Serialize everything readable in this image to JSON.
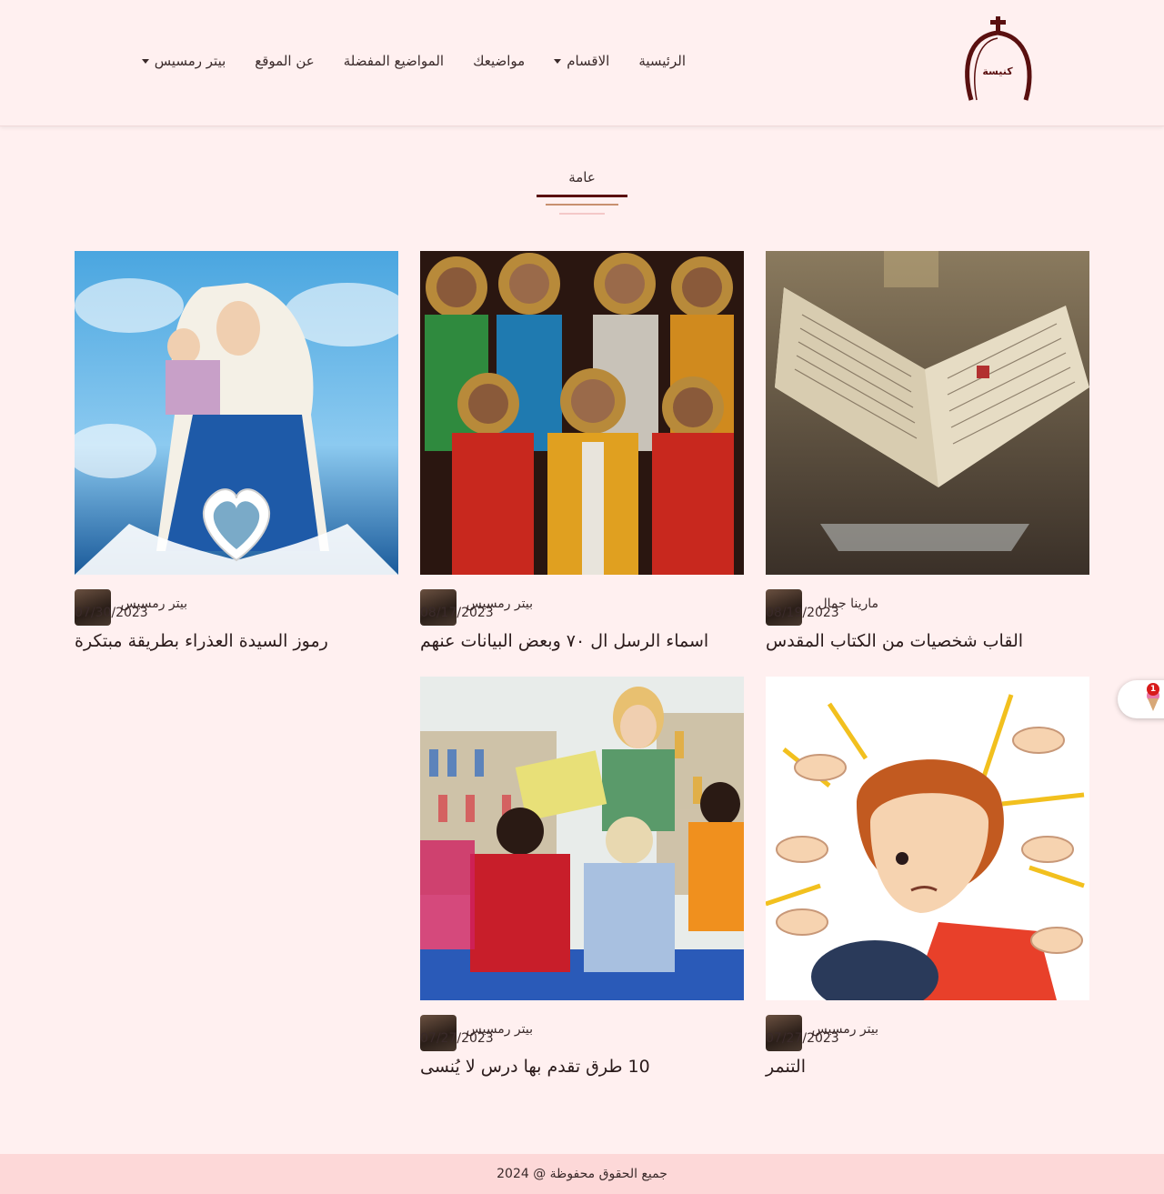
{
  "nav": {
    "items": [
      {
        "label": "الرئيسية",
        "has_dropdown": false
      },
      {
        "label": "الاقسام",
        "has_dropdown": true
      },
      {
        "label": "مواضيعك",
        "has_dropdown": false
      },
      {
        "label": "المواضيع المفضلة",
        "has_dropdown": false
      },
      {
        "label": "عن الموقع",
        "has_dropdown": false
      },
      {
        "label": "بيتر رمسيس",
        "has_dropdown": true
      }
    ]
  },
  "logo": {
    "text": "كنيسة"
  },
  "section": {
    "title": "عامة"
  },
  "posts": [
    {
      "title": "القاب شخصيات من الكتاب المقدس",
      "author": "مارينا جمال",
      "date": "08/19/2023",
      "image": "open-bible"
    },
    {
      "title": "اسماء الرسل ال ٧٠ وبعض البيانات عنهم",
      "author": "بيتر رمسيس",
      "date": "08/17/2023",
      "image": "apostles-icon"
    },
    {
      "title": "رموز السيدة العذراء بطريقة مبتكرة",
      "author": "بيتر رمسيس",
      "date": "07/30/2023",
      "image": "virgin-mary"
    },
    {
      "title": "التنمر",
      "author": "بيتر رمسيس",
      "date": "07/27/2023",
      "image": "bullying-cartoon"
    },
    {
      "title": "10 طرق تقدم بها درس لا يُنسى",
      "author": "بيتر رمسيس",
      "date": "07/27/2023",
      "image": "classroom"
    }
  ],
  "widget": {
    "badge": "1"
  },
  "footer": {
    "text": "جميع الحقوق محفوظة @ 2024"
  },
  "colors": {
    "accent": "#5a1010",
    "background": "#fff0f0",
    "footer": "#fdd8d8"
  }
}
